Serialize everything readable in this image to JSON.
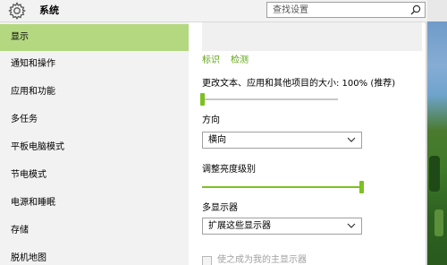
{
  "window": {
    "title": "系统",
    "search_placeholder": "查找设置"
  },
  "sidebar": {
    "items": [
      {
        "label": "显示",
        "selected": true
      },
      {
        "label": "通知和操作"
      },
      {
        "label": "应用和功能"
      },
      {
        "label": "多任务"
      },
      {
        "label": "平板电脑模式"
      },
      {
        "label": "节电模式"
      },
      {
        "label": "电源和睡眠"
      },
      {
        "label": "存储"
      },
      {
        "label": "脱机地图"
      }
    ]
  },
  "main": {
    "links": {
      "identify": "标识",
      "detect": "检测"
    },
    "scale": {
      "label": "更改文本、应用和其他项目的大小: 100% (推荐)",
      "value_fraction": 0.0
    },
    "orientation": {
      "label": "方向",
      "value": "横向"
    },
    "brightness": {
      "label": "调整亮度级别",
      "value_fraction": 1.0
    },
    "multiple_displays": {
      "label": "多显示器",
      "value": "扩展这些显示器"
    },
    "main_display_checkbox": {
      "label": "使之成为我的主显示器",
      "checked": false,
      "enabled": false
    }
  },
  "colors": {
    "accent": "#7dc023",
    "sidebar_selected": "#b4d880",
    "link": "#5ea312"
  }
}
